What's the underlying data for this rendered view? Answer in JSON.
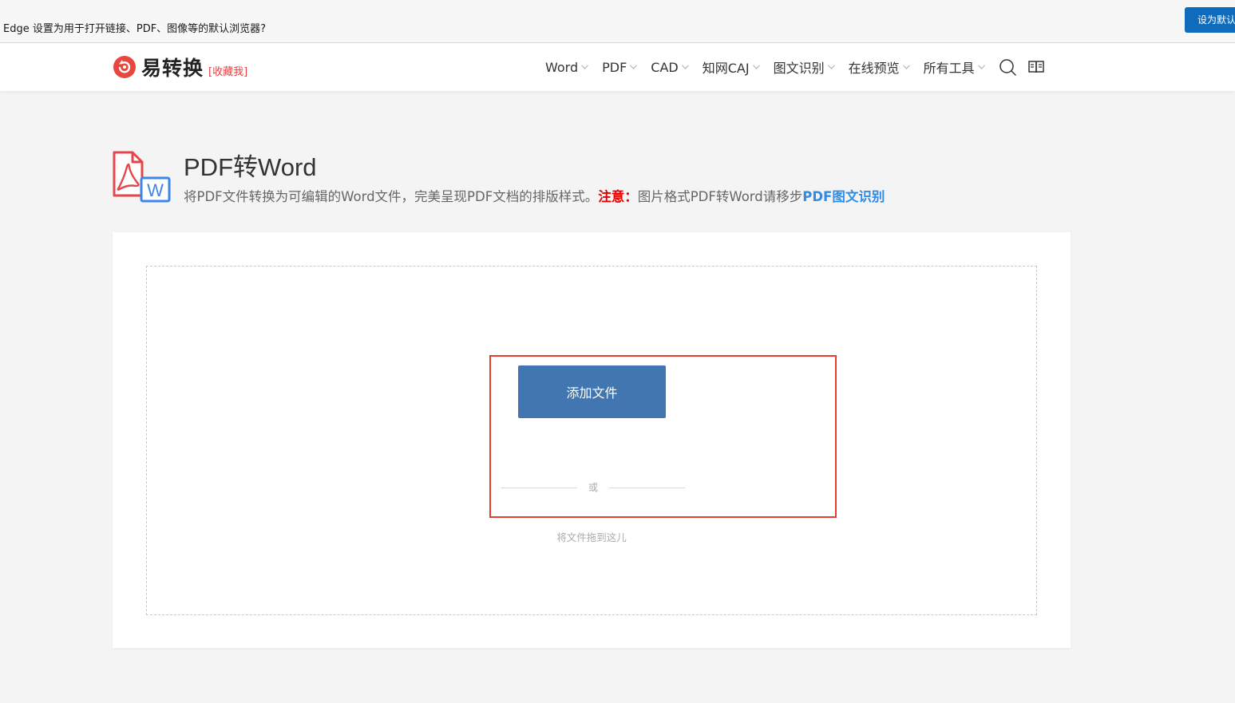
{
  "edge_bar": {
    "message": "Edge 设置为用于打开链接、PDF、图像等的默认浏览器?",
    "set_default_button": "设为默认"
  },
  "header": {
    "logo_text": "易转换",
    "bookmark": "[收藏我]",
    "nav": [
      {
        "label": "Word"
      },
      {
        "label": "PDF"
      },
      {
        "label": "CAD"
      },
      {
        "label": "知网CAJ"
      },
      {
        "label": "图文识别"
      },
      {
        "label": "在线预览"
      },
      {
        "label": "所有工具"
      }
    ],
    "icons": [
      "search-icon",
      "book-icon"
    ]
  },
  "page": {
    "title": "PDF转Word",
    "description": "将PDF文件转换为可编辑的Word文件，完美呈现PDF文档的排版样式。",
    "note_label": "注意：",
    "note_text": "图片格式PDF转Word请移步",
    "note_link": "PDF图文识别",
    "icon_badge": "W"
  },
  "upload": {
    "add_button": "添加文件",
    "or": "或",
    "drag_hint": "将文件拖到这儿"
  },
  "colors": {
    "accent_red": "#e53b2c",
    "button_blue": "#4276b0",
    "link_blue": "#2f8ce7",
    "edge_blue": "#0f6cbd"
  }
}
